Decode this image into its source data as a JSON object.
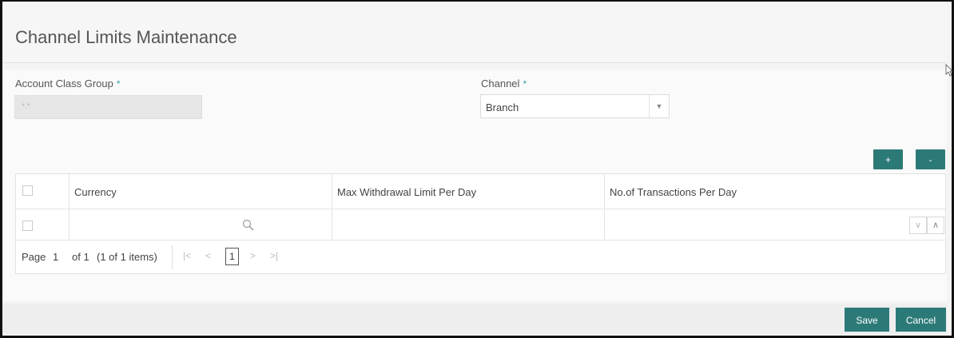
{
  "page": {
    "title": "Channel Limits Maintenance"
  },
  "form": {
    "account_class_group": {
      "label": "Account Class Group",
      "required_mark": "*",
      "value": "*.*"
    },
    "channel": {
      "label": "Channel",
      "required_mark": "*",
      "value": "Branch"
    }
  },
  "grid": {
    "add_label": "+",
    "remove_label": "-",
    "columns": [
      "Currency",
      "Max Withdrawal Limit Per Day",
      "No.of Transactions Per Day"
    ],
    "rows": [
      {
        "currency": "",
        "max_withdrawal": "",
        "transactions": ""
      }
    ],
    "pager": {
      "page_label": "Page",
      "page_number": "1",
      "of_text": "of 1",
      "items_text": "(1 of 1 items)",
      "current": "1"
    }
  },
  "footer": {
    "save_label": "Save",
    "cancel_label": "Cancel"
  },
  "colors": {
    "accent": "#2c7a78",
    "required": "#3aa0a8"
  },
  "icons": [
    "search-icon",
    "chevron-down-icon",
    "chevron-up-icon",
    "first-page-icon",
    "prev-page-icon",
    "next-page-icon",
    "last-page-icon"
  ]
}
